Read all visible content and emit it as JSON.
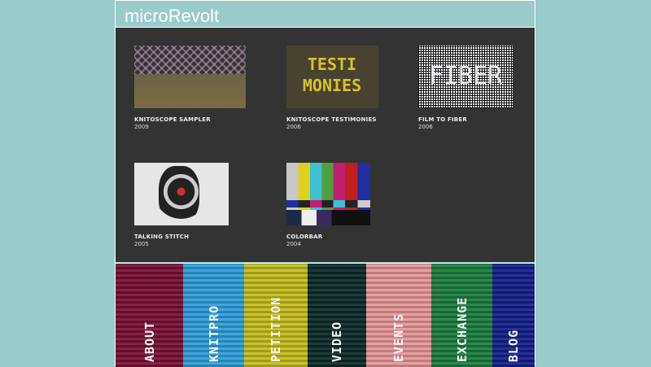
{
  "header": {
    "title": "microRevolt"
  },
  "projects": [
    {
      "name": "KNITOSCOPE SAMPLER",
      "year": "2009",
      "thumb_text": ""
    },
    {
      "name": "KNITOSCOPE TESTIMONIES",
      "year": "2006",
      "thumb_text": "TESTI MONIES"
    },
    {
      "name": "FILM TO FIBER",
      "year": "2006",
      "thumb_text": "FIBER"
    },
    {
      "name": "TALKING STITCH",
      "year": "2005",
      "thumb_text": ""
    },
    {
      "name": "COLORBAR",
      "year": "2004",
      "thumb_text": ""
    }
  ],
  "nav": [
    {
      "label": "ABOUT",
      "color": "#7a1035"
    },
    {
      "label": "KNITPRO",
      "color": "#2f9fdc"
    },
    {
      "label": "PETITION",
      "color": "#c6bd1e"
    },
    {
      "label": "VIDEO",
      "color": "#0d2a2a"
    },
    {
      "label": "EVENTS",
      "color": "#e6979a"
    },
    {
      "label": "EXCHANGE",
      "color": "#1b7e40"
    },
    {
      "label": "BLOG",
      "color": "#14208a"
    }
  ]
}
